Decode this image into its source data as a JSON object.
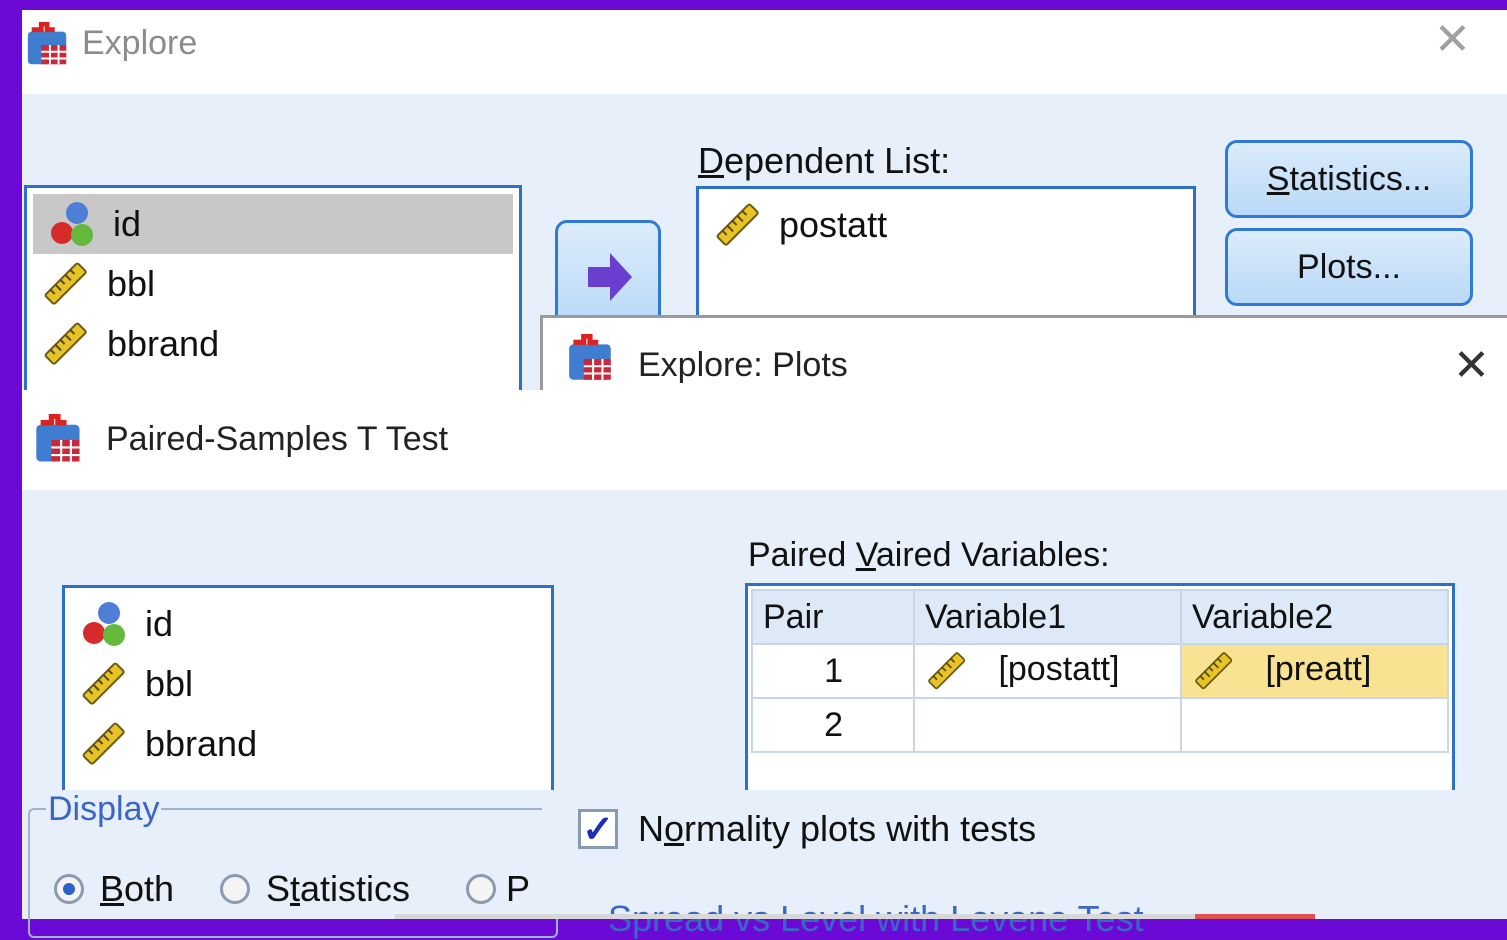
{
  "explore": {
    "title": "Explore",
    "variables": [
      "id",
      "bbl",
      "bbrand"
    ],
    "dependent_list_label": "Dependent List:",
    "dependent_items": [
      "postatt"
    ],
    "statistics_button": "Statistics...",
    "plots_button": "Plots..."
  },
  "explore_plots": {
    "title": "Explore: Plots",
    "normality_label": "Normality plots with tests",
    "spread_label": "Spread vs Level with Levene Test"
  },
  "paired": {
    "title": "Paired-Samples T Test",
    "variables": [
      "id",
      "bbl",
      "bbrand"
    ],
    "paired_label": "Paired Variables:",
    "columns": [
      "Pair",
      "Variable1",
      "Variable2"
    ],
    "rows": [
      {
        "pair": "1",
        "var1": "[postatt]",
        "var2": "[preatt]"
      },
      {
        "pair": "2",
        "var1": "",
        "var2": ""
      }
    ]
  },
  "display": {
    "label": "Display",
    "options": [
      "Both",
      "Statistics",
      "P"
    ]
  },
  "colors": {
    "backdrop": "#6b0ad6",
    "accent_border": "#2e6fc7",
    "selected_cell": "#f7e391"
  }
}
